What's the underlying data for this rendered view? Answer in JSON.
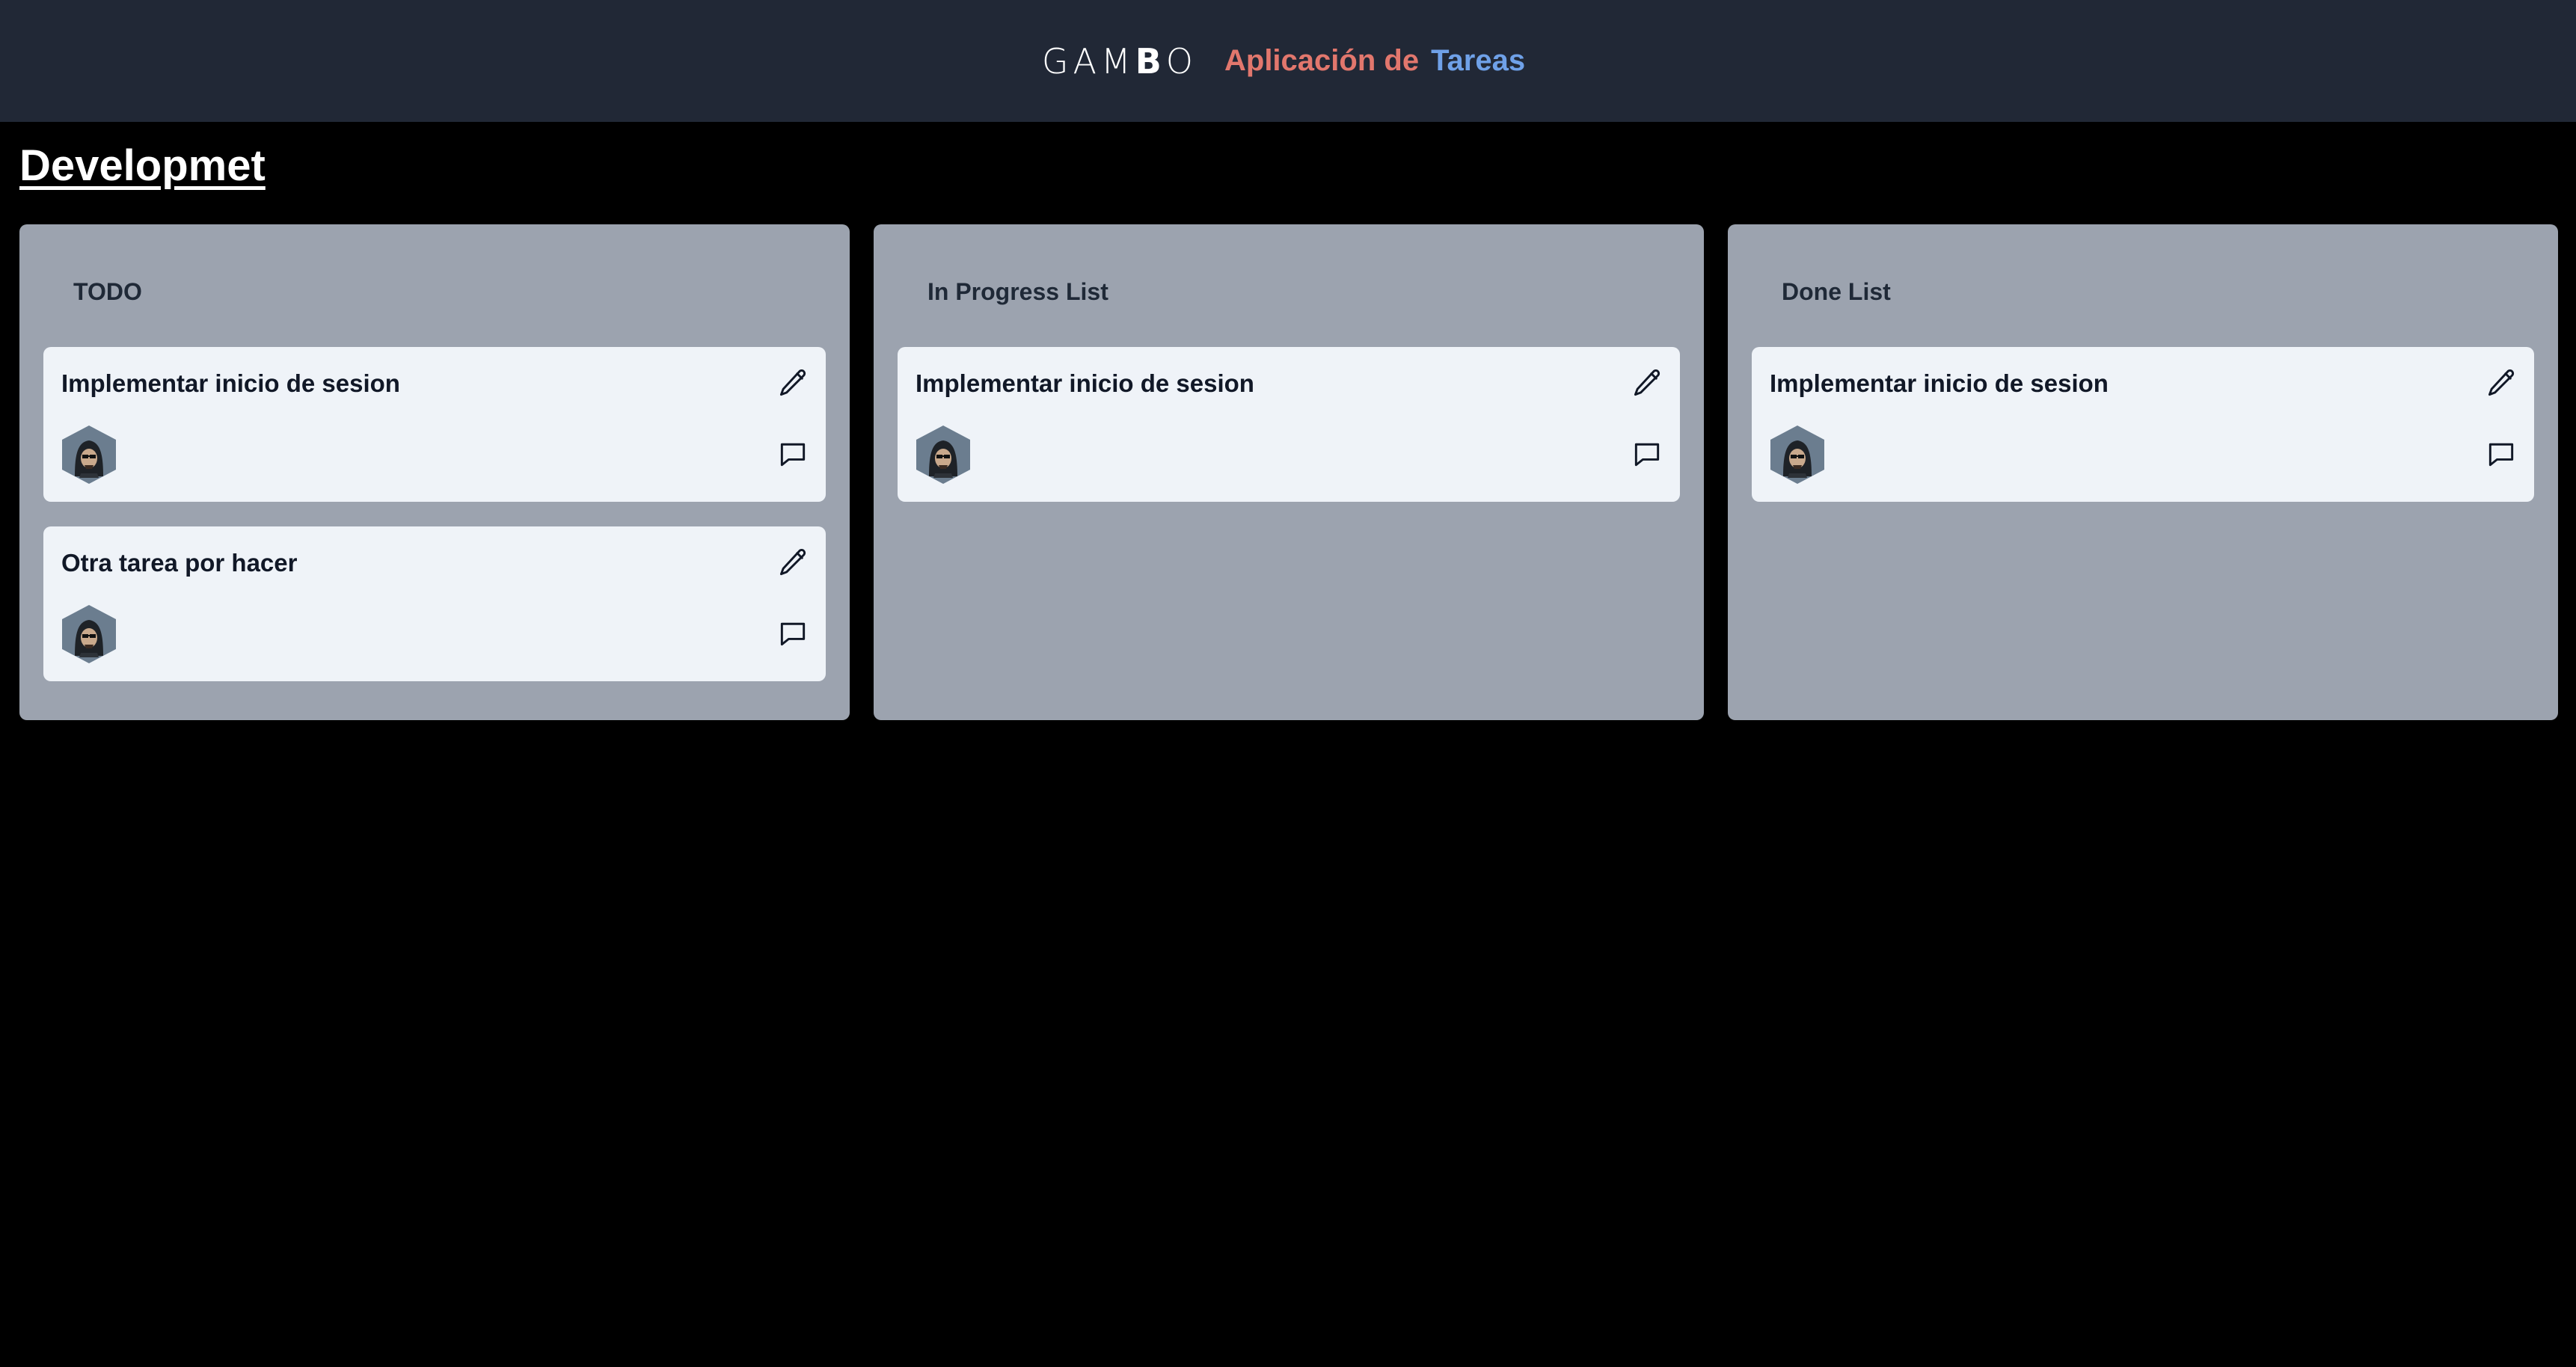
{
  "header": {
    "logo": {
      "part1": "GAM",
      "part2": "B",
      "part3": "O"
    },
    "title_part1": "Aplicación de",
    "title_part2": "Tareas"
  },
  "board": {
    "title": "Developmet",
    "columns": [
      {
        "title": "TODO",
        "cards": [
          {
            "title": "Implementar inicio de sesion",
            "avatar": "hooded-avatar",
            "edit_icon": "pencil-icon",
            "comment_icon": "comment-icon"
          },
          {
            "title": "Otra tarea por hacer",
            "avatar": "hooded-avatar",
            "edit_icon": "pencil-icon",
            "comment_icon": "comment-icon"
          }
        ]
      },
      {
        "title": "In Progress List",
        "cards": [
          {
            "title": "Implementar inicio de sesion",
            "avatar": "hooded-avatar",
            "edit_icon": "pencil-icon",
            "comment_icon": "comment-icon"
          }
        ]
      },
      {
        "title": "Done List",
        "cards": [
          {
            "title": "Implementar inicio de sesion",
            "avatar": "hooded-avatar",
            "edit_icon": "pencil-icon",
            "comment_icon": "comment-icon"
          }
        ]
      }
    ]
  },
  "colors": {
    "header_bg": "#212836",
    "page_bg": "#000000",
    "column_bg": "#9ca3af",
    "card_bg": "#eff3f8",
    "accent_red": "#e2776d",
    "accent_blue": "#6fa1e8"
  }
}
